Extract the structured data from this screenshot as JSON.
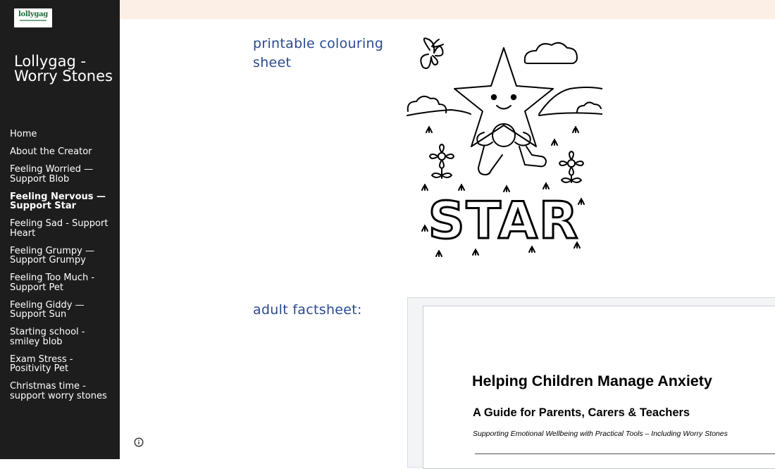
{
  "sidebar": {
    "logo_text": "lollygag",
    "site_title": "Lollygag - Worry Stones",
    "nav": [
      {
        "label": "Home",
        "active": false
      },
      {
        "label": "About the Creator",
        "active": false
      },
      {
        "label": "Feeling Worried — Support Blob",
        "active": false
      },
      {
        "label": "Feeling Nervous — Support Star",
        "active": true
      },
      {
        "label": "Feeling Sad - Support Heart",
        "active": false
      },
      {
        "label": "Feeling Grumpy — Support Grumpy",
        "active": false
      },
      {
        "label": "Feeling Too Much - Support Pet",
        "active": false
      },
      {
        "label": "Feeling Giddy — Support Sun",
        "active": false
      },
      {
        "label": "Starting school - smiley blob",
        "active": false
      },
      {
        "label": "Exam Stress - Positivity Pet",
        "active": false
      },
      {
        "label": "Christmas time - support worry stones",
        "active": false
      }
    ]
  },
  "main": {
    "section1_heading": "printable colouring sheet",
    "colouring_word": "STAR",
    "section2_heading": "adult factsheet:",
    "document": {
      "title": "Helping Children Manage Anxiety",
      "subtitle": "A Guide for Parents, Carers & Teachers",
      "tagline": "Supporting Emotional Wellbeing with Practical Tools – Including Worry Stones"
    }
  },
  "colors": {
    "sidebar_bg": "#1d1d1d",
    "heading": "#2a4a8f",
    "top_band": "#fcefe6"
  },
  "icons": {
    "footer_info": "info-icon"
  }
}
